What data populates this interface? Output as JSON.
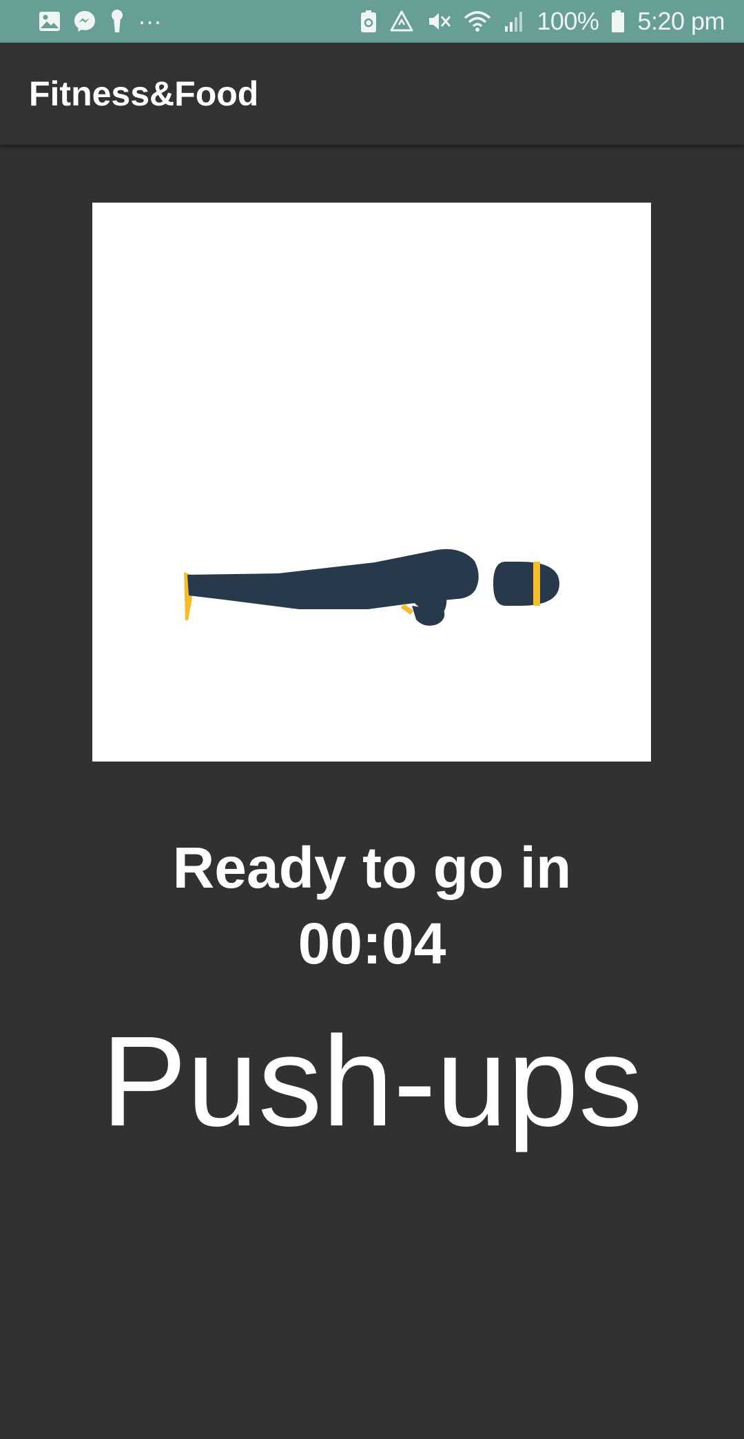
{
  "status_bar": {
    "battery_text": "100%",
    "time": "5:20 pm",
    "more_indicator": "···",
    "icons_left": [
      "gallery-icon",
      "messenger-icon",
      "keyhole-icon"
    ],
    "icons_right": [
      "battery-saver-icon",
      "data-sync-icon",
      "mute-icon",
      "wifi-icon",
      "signal-icon",
      "battery-icon"
    ],
    "bg_color": "#679e96"
  },
  "app_bar": {
    "title": "Fitness&Food"
  },
  "main": {
    "image_icon": "pushup-figure-icon",
    "ready_label": "Ready to go in",
    "countdown": "00:04",
    "exercise_name": "Push-ups"
  },
  "colors": {
    "background": "#313131",
    "figure_body": "#27394a",
    "figure_accent": "#f3bd2c"
  }
}
